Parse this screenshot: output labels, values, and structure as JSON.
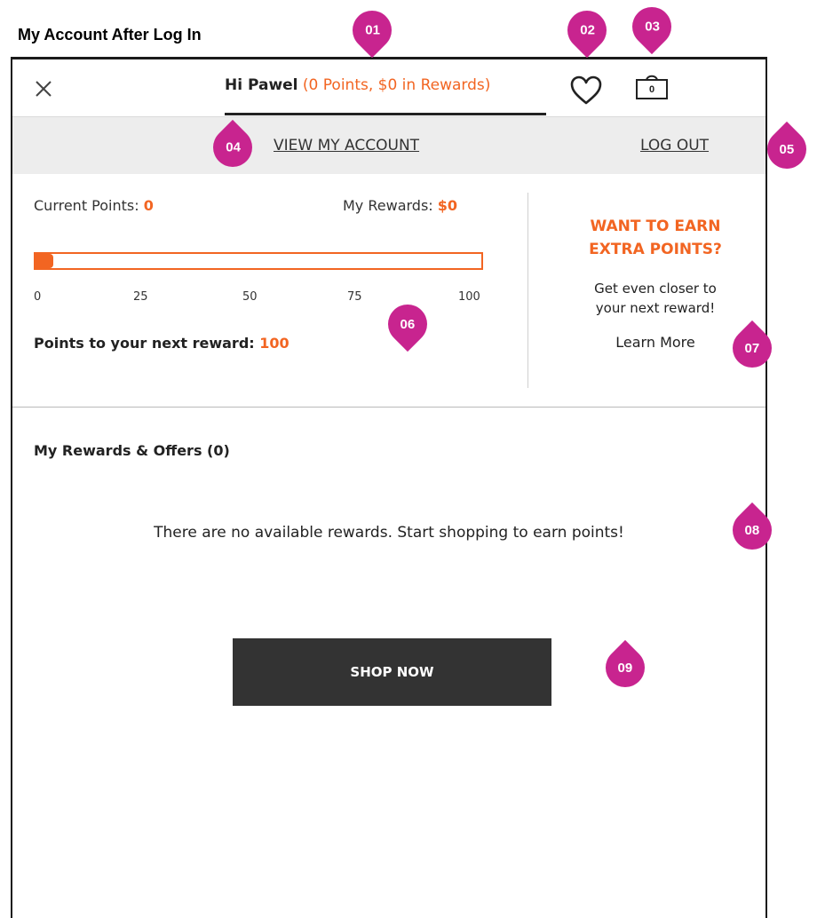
{
  "page_title": "My Account After Log In",
  "header": {
    "greeting_name": "Hi Pawel",
    "greeting_points": "(0 Points, $0 in Rewards)",
    "bag_count": "0"
  },
  "account_bar": {
    "view_account": "VIEW MY ACCOUNT",
    "log_out": "LOG OUT"
  },
  "points": {
    "current_label": "Current Points:",
    "current_value": "0",
    "rewards_label": "My Rewards:",
    "rewards_value": "$0",
    "progress_fraction": 0.04,
    "ticks": [
      "0",
      "25",
      "50",
      "75",
      "100"
    ],
    "next_label": "Points to your next reward:",
    "next_value": "100"
  },
  "promo": {
    "title_line1": "WANT TO EARN",
    "title_line2": "EXTRA POINTS?",
    "text_line1": "Get even closer to",
    "text_line2": "your next reward!",
    "learn_more": "Learn More"
  },
  "offers": {
    "heading": "My Rewards & Offers (0)",
    "empty_message": "There are no available rewards. Start shopping to earn points!"
  },
  "shop_button": "SHOP NOW",
  "annotations": [
    "01",
    "02",
    "03",
    "04",
    "05",
    "06",
    "07",
    "08",
    "09"
  ],
  "colors": {
    "accent": "#f26522",
    "marker": "#c8248f",
    "button": "#333333",
    "account_bar_bg": "#ededed"
  },
  "icons": [
    "close-icon",
    "heart-icon",
    "shopping-bag-icon"
  ]
}
